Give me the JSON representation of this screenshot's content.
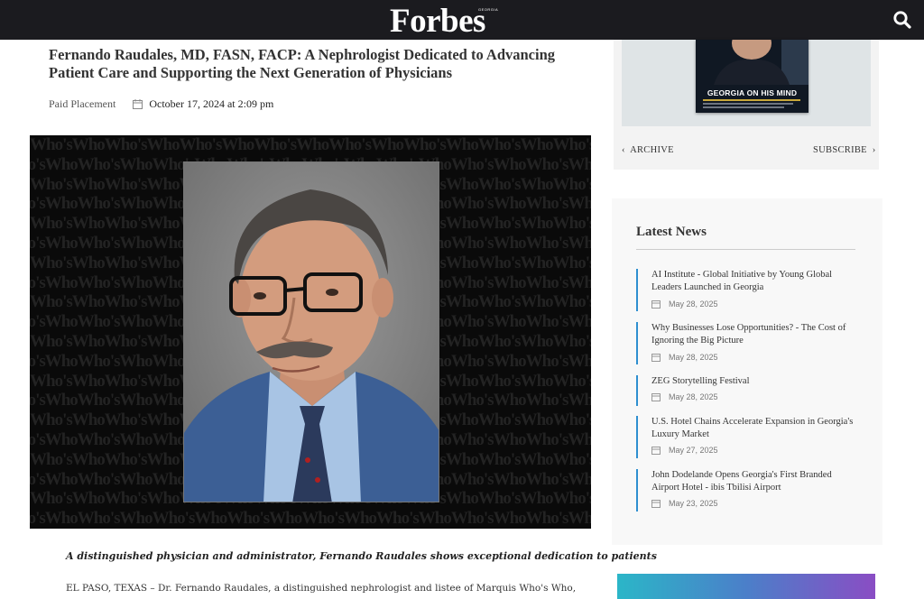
{
  "header": {
    "logo": "Forbes",
    "logo_sub": "GEORGIA",
    "search_icon": "search-icon"
  },
  "article": {
    "title": "Fernando Raudales, MD, FASN, FACP: A Nephrologist Dedicated to Advancing Patient Care and Supporting the Next Generation of Physicians",
    "label": "Paid Placement",
    "date": "October 17, 2024 at 2:09 pm",
    "hero_pattern_word": "Who'sWho",
    "lead": "A distinguished physician and administrator, Fernando Raudales shows exceptional dedication to patients",
    "body": "EL PASO, TEXAS – Dr. Fernando Raudales, a distinguished nephrologist and listee of Marquis Who's Who, has been"
  },
  "sidebar": {
    "magazine_title": "GEORGIA ON HIS MIND",
    "archive_label": "ARCHIVE",
    "subscribe_label": "SUBSCRIBE",
    "latest_news_heading": "Latest News",
    "news": [
      {
        "title": "AI Institute - Global Initiative by Young Global Leaders Launched in Georgia",
        "date": "May 28, 2025"
      },
      {
        "title": "Why Businesses Lose Opportunities? - The Cost of Ignoring the Big Picture",
        "date": "May 28, 2025"
      },
      {
        "title": "ZEG Storytelling Festival",
        "date": "May 28, 2025"
      },
      {
        "title": "U.S. Hotel Chains Accelerate Expansion in Georgia's Luxury Market",
        "date": "May 27, 2025"
      },
      {
        "title": "John Dodelande Opens Georgia's First Branded Airport Hotel - ibis Tbilisi Airport",
        "date": "May 23, 2025"
      }
    ]
  },
  "colors": {
    "header_bg": "#1b1b1f",
    "accent": "#2e8fd0"
  }
}
